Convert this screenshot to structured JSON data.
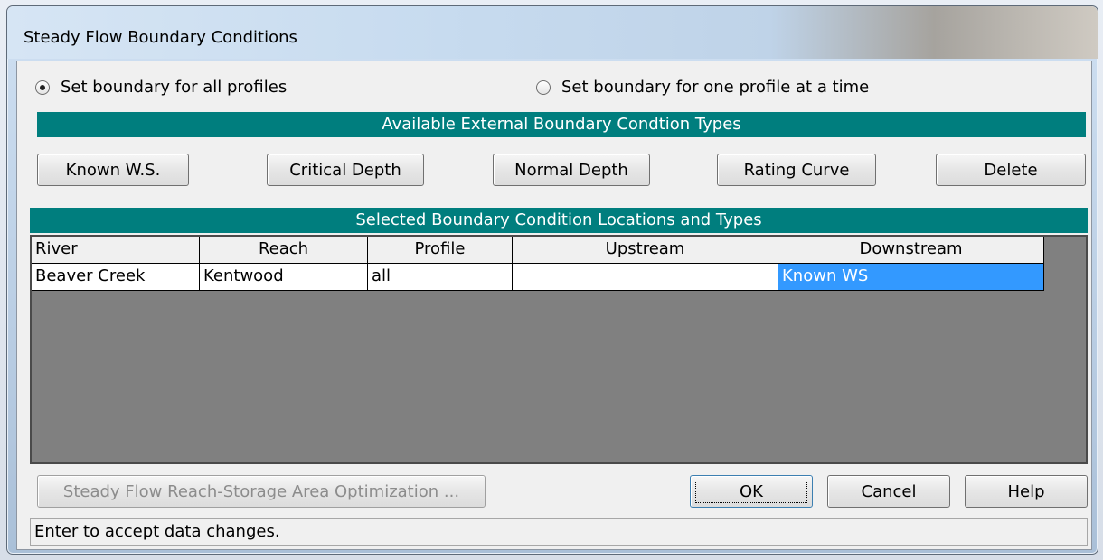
{
  "window": {
    "title": "Steady Flow Boundary Conditions"
  },
  "options": {
    "all_profiles": {
      "label": "Set boundary for all profiles",
      "checked": true
    },
    "one_profile": {
      "label": "Set boundary for one profile at a time",
      "checked": false
    }
  },
  "types_header": "Available External Boundary Condtion Types",
  "type_buttons": {
    "known_ws": "Known W.S.",
    "critical_depth": "Critical Depth",
    "normal_depth": "Normal Depth",
    "rating_curve": "Rating Curve",
    "delete": "Delete"
  },
  "locations_header": "Selected Boundary Condition Locations and Types",
  "table": {
    "columns": [
      "River",
      "Reach",
      "Profile",
      "Upstream",
      "Downstream"
    ],
    "rows": [
      {
        "river": "Beaver Creek",
        "reach": "Kentwood",
        "profile": "all",
        "upstream": "",
        "downstream": "Known WS"
      }
    ]
  },
  "bottom_buttons": {
    "optimization": "Steady Flow Reach-Storage Area Optimization ...",
    "ok": "OK",
    "cancel": "Cancel",
    "help": "Help"
  },
  "status_text": "Enter to accept data changes.",
  "colors": {
    "header_teal": "#007E7E",
    "selection_blue": "#3399FF",
    "grid_bg": "#808080"
  }
}
